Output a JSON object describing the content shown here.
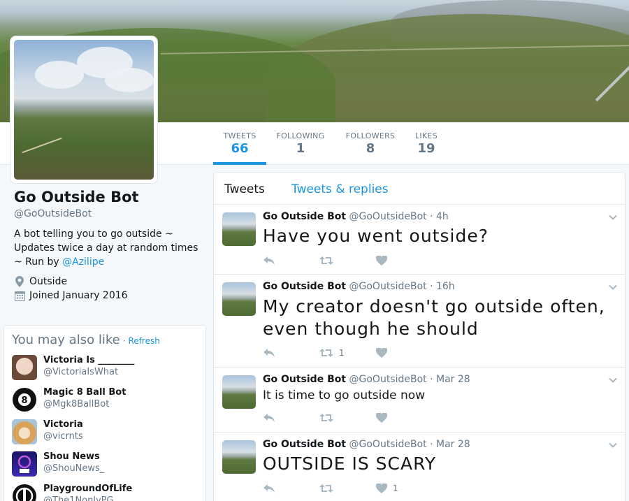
{
  "colors": {
    "accent": "#1b95e0",
    "muted": "#657786",
    "border": "#e1e8ed",
    "text": "#14171a",
    "background": "#f5f8fa"
  },
  "nav": {
    "stats": [
      {
        "label": "TWEETS",
        "value": "66",
        "active": true
      },
      {
        "label": "FOLLOWING",
        "value": "1",
        "active": false
      },
      {
        "label": "FOLLOWERS",
        "value": "8",
        "active": false
      },
      {
        "label": "LIKES",
        "value": "19",
        "active": false
      }
    ]
  },
  "profile": {
    "name": "Go Outside Bot",
    "handle": "@GoOutsideBot",
    "bio_text": "A bot telling you to go outside ~ Updates twice a day at random times ~ Run by ",
    "bio_link": "@Azilipe",
    "location": "Outside",
    "joined": "Joined January 2016",
    "location_icon": "map-pin-icon",
    "joined_icon": "calendar-icon"
  },
  "who_to_follow": {
    "title": "You may also like",
    "separator": "·",
    "refresh": "Refresh",
    "suggestions": [
      {
        "name": "Victoria Is ________",
        "handle": "@VictoriaIsWhat",
        "avatar": "face-photo"
      },
      {
        "name": "Magic 8 Ball Bot",
        "handle": "@Mgk8BallBot",
        "avatar": "eight-ball-icon"
      },
      {
        "name": "Victoria",
        "handle": "@vicrnts",
        "avatar": "dog-photo"
      },
      {
        "name": "Shou News",
        "handle": "@ShouNews_",
        "avatar": "news-logo"
      },
      {
        "name": "PlaygroundOfLife",
        "handle": "@The1NonlyPG",
        "avatar": "pg-logo"
      }
    ]
  },
  "timeline": {
    "tabs": [
      "Tweets",
      "Tweets & replies"
    ],
    "tweets": [
      {
        "name": "Go Outside Bot",
        "handle": "@GoOutsideBot",
        "time": "· 4h",
        "text": "Have you went outside?",
        "retweets": "",
        "likes": ""
      },
      {
        "name": "Go Outside Bot",
        "handle": "@GoOutsideBot",
        "time": "· 16h",
        "text": "My creator doesn't go outside often, even though he should",
        "retweets": "1",
        "likes": ""
      },
      {
        "name": "Go Outside Bot",
        "handle": "@GoOutsideBot",
        "time": "· Mar 28",
        "text": "It is time to go outside now",
        "retweets": "",
        "likes": ""
      },
      {
        "name": "Go Outside Bot",
        "handle": "@GoOutsideBot",
        "time": "· Mar 28",
        "text": "OUTSIDE IS SCARY",
        "retweets": "",
        "likes": "1"
      }
    ]
  }
}
